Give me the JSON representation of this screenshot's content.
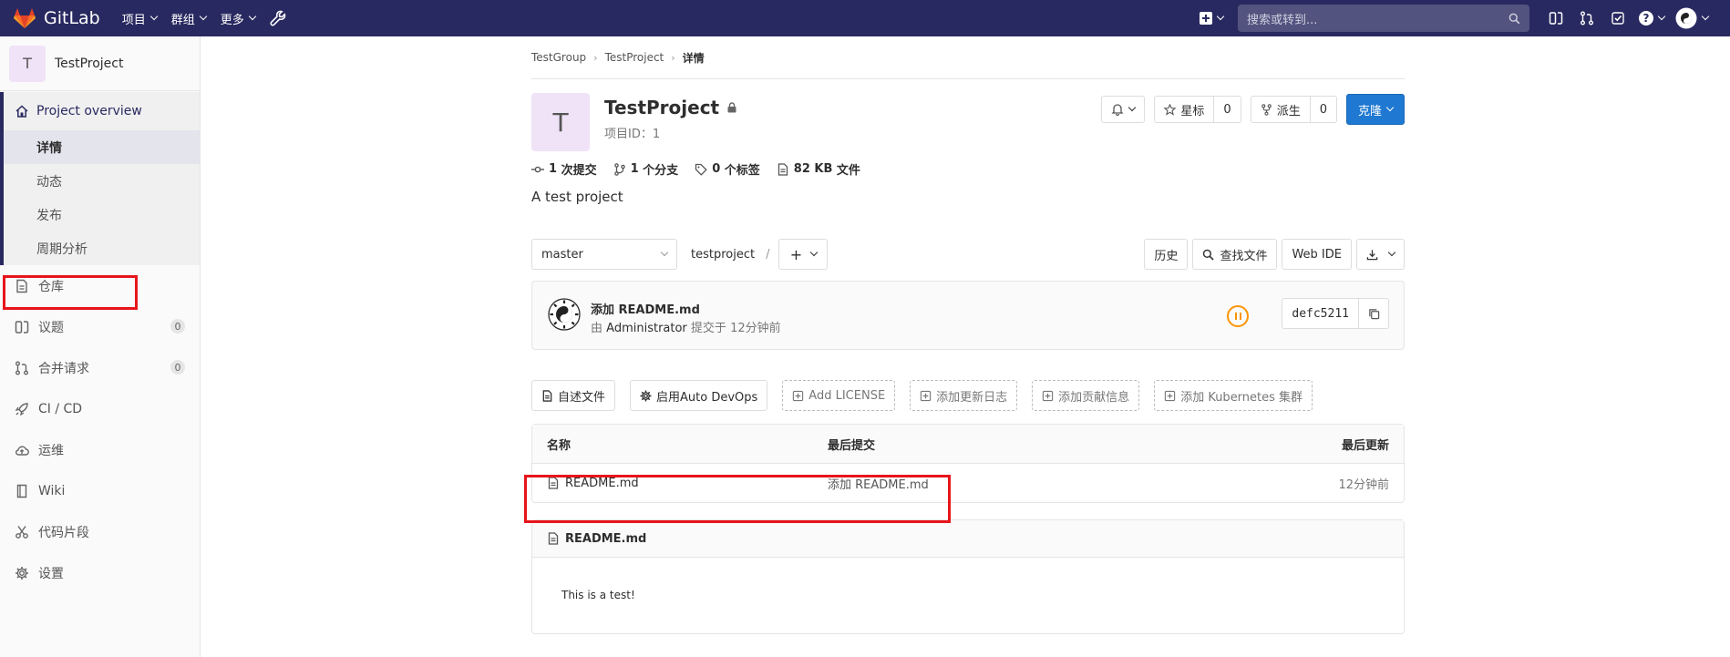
{
  "navbar": {
    "brand": "GitLab",
    "menu": [
      "项目",
      "群组",
      "更多"
    ],
    "search_placeholder": "搜索或转到..."
  },
  "sidebar": {
    "project_initial": "T",
    "project_name": "TestProject",
    "overview": {
      "label": "Project overview",
      "items": [
        {
          "label": "详情",
          "active": true
        },
        {
          "label": "动态"
        },
        {
          "label": "发布"
        },
        {
          "label": "周期分析"
        }
      ]
    },
    "items": [
      {
        "label": "仓库",
        "icon": "repository-icon"
      },
      {
        "label": "议题",
        "icon": "issues-icon",
        "count": "0"
      },
      {
        "label": "合并请求",
        "icon": "merge-request-icon",
        "count": "0"
      },
      {
        "label": "CI / CD",
        "icon": "rocket-icon"
      },
      {
        "label": "运维",
        "icon": "cloud-icon"
      },
      {
        "label": "Wiki",
        "icon": "book-icon"
      },
      {
        "label": "代码片段",
        "icon": "scissors-icon"
      },
      {
        "label": "设置",
        "icon": "gear-icon"
      }
    ]
  },
  "breadcrumb": [
    "TestGroup",
    "TestProject",
    "详情"
  ],
  "project": {
    "initial": "T",
    "name": "TestProject",
    "id_label": "项目ID：1",
    "description": "A test project",
    "star_label": "星标",
    "star_count": "0",
    "fork_label": "派生",
    "fork_count": "0",
    "clone_label": "克隆"
  },
  "stats": {
    "commits_num": "1",
    "commits_label": "次提交",
    "branches_num": "1",
    "branches_label": "个分支",
    "tags_num": "0",
    "tags_label": "个标签",
    "size_num": "82 KB",
    "size_label": "文件"
  },
  "tree": {
    "branch": "master",
    "path": "testproject",
    "path_sep": "/",
    "history": "历史",
    "find_file": "查找文件",
    "web_ide": "Web IDE"
  },
  "commit": {
    "title": "添加 README.md",
    "by": "由",
    "author": "Administrator",
    "committed": "提交于",
    "time": "12分钟前",
    "sha": "defc5211"
  },
  "quick_actions": [
    "自述文件",
    "启用Auto DevOps",
    "Add LICENSE",
    "添加更新日志",
    "添加贡献信息",
    "添加 Kubernetes 集群"
  ],
  "files": {
    "headers": [
      "名称",
      "最后提交",
      "最后更新"
    ],
    "rows": [
      {
        "name": "README.md",
        "last_commit": "添加 README.md",
        "updated": "12分钟前"
      }
    ]
  },
  "readme": {
    "filename": "README.md",
    "content": "This is a test!"
  },
  "colors": {
    "navbar": "#292961",
    "accent_blue": "#1f78d1",
    "highlight_red": "#e8141b",
    "pipeline_orange": "#fc9403",
    "avatar_bg": "#f0e2f7"
  }
}
